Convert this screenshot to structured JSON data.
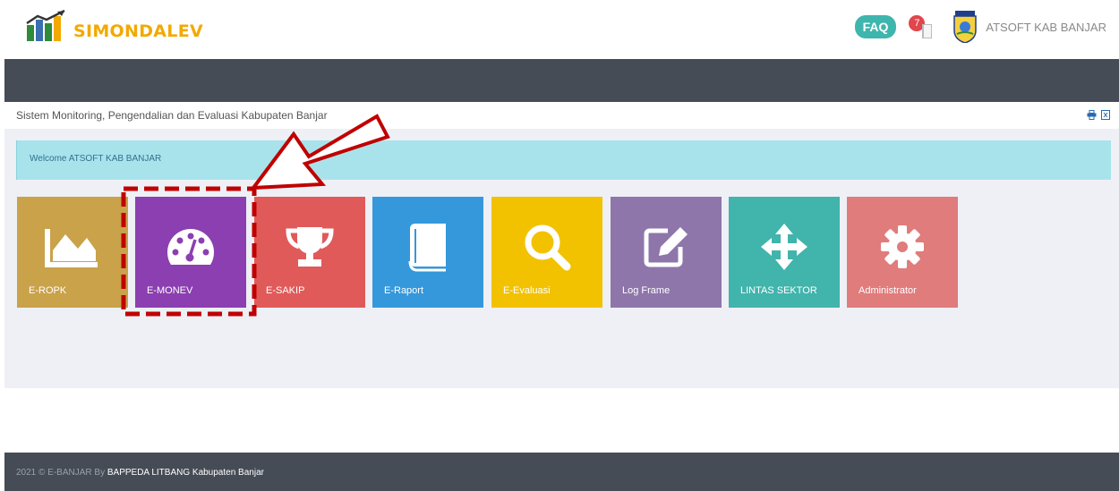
{
  "header": {
    "app_name": "SIMONDALEV",
    "faq_label": "FAQ",
    "notification_count": "7",
    "user_name": "ATSOFT KAB BANJAR"
  },
  "breadcrumb": {
    "title": "Sistem Monitoring, Pengendalian dan Evaluasi Kabupaten Banjar",
    "icons": [
      "print-icon",
      "excel-icon"
    ]
  },
  "welcome": {
    "text": "Welcome ATSOFT KAB BANJAR"
  },
  "tiles": [
    {
      "label": "E-ROPK",
      "icon": "area-chart-icon",
      "color": "#c9a24a"
    },
    {
      "label": "E-MONEV",
      "icon": "dashboard-icon",
      "color": "#8b3fb0"
    },
    {
      "label": "E-SAKIP",
      "icon": "trophy-icon",
      "color": "#e05a5a"
    },
    {
      "label": "E-Raport",
      "icon": "book-icon",
      "color": "#3498db"
    },
    {
      "label": "E-Evaluasi",
      "icon": "search-icon",
      "color": "#f2c200"
    },
    {
      "label": "Log Frame",
      "icon": "edit-icon",
      "color": "#8e76ab"
    },
    {
      "label": "LINTAS SEKTOR",
      "icon": "move-icon",
      "color": "#41b4ac"
    },
    {
      "label": "Administrator",
      "icon": "gear-icon",
      "color": "#e07c7c"
    }
  ],
  "footer": {
    "prefix": "2021 © E-BANJAR By ",
    "org": "BAPPEDA LITBANG Kabupaten Banjar"
  },
  "annotation": {
    "highlight_color": "#c00000",
    "highlighted_tile": "E-MONEV"
  }
}
